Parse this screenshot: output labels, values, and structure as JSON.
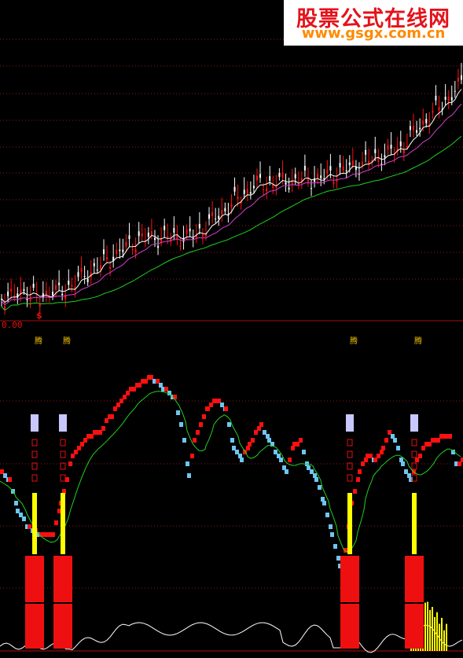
{
  "watermark": {
    "title": "股票公式在线网",
    "url": "www.gsgx.com.cn"
  },
  "indicator": {
    "zero_label": "0.00"
  },
  "price_panel": {
    "marker": "$"
  },
  "signals": {
    "labels": [
      "腾",
      "腾",
      "腾",
      "腾"
    ]
  },
  "colors": {
    "bull": "#ff1010",
    "bear": "#6ec6f0",
    "ma_white": "#ffffff",
    "ma_magenta": "#d040d0",
    "ma_green": "#20d020",
    "signal_yellow": "#ffff00",
    "grid": "#8b1a1a"
  },
  "chart_data": [
    {
      "type": "candlestick",
      "title": "",
      "lines": [
        "MA-white",
        "MA-magenta",
        "MA-green"
      ],
      "grid": true
    },
    {
      "type": "line",
      "title": "",
      "y_zero_label": "0.00",
      "signal_count": 4
    }
  ]
}
